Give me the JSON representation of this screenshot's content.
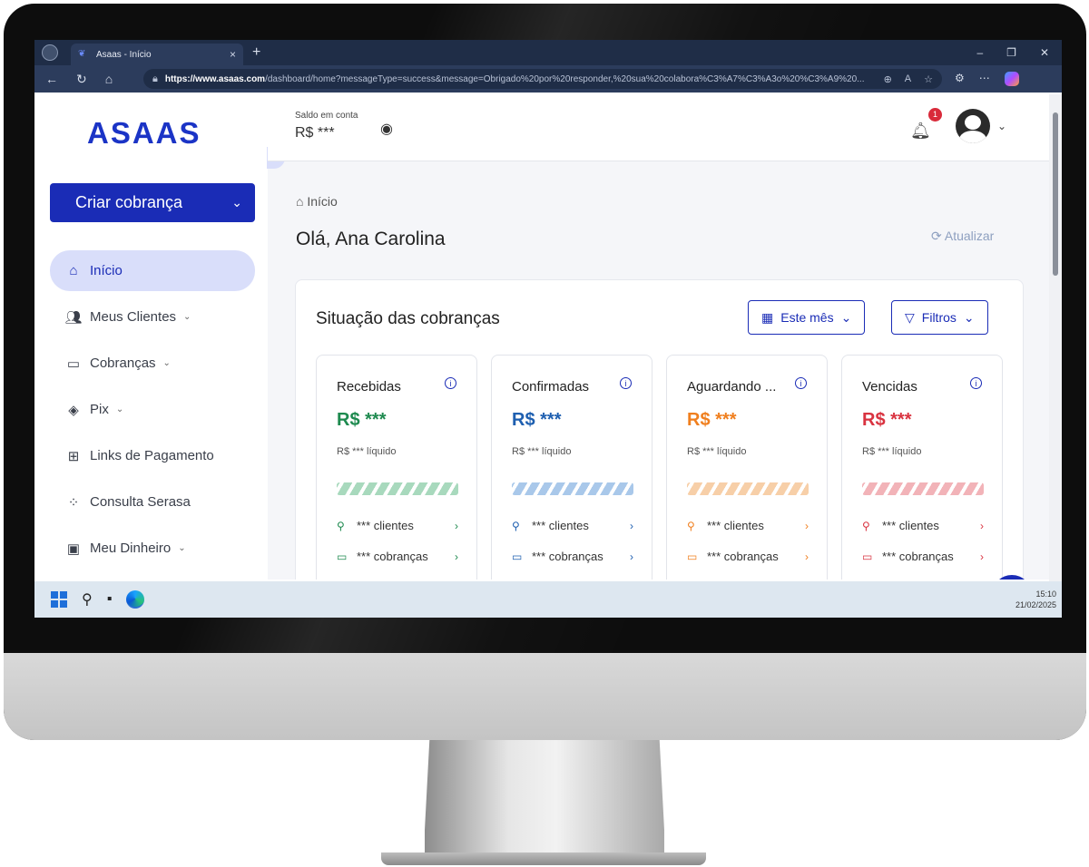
{
  "browser": {
    "tab_title": "Asaas - Início",
    "url_host": "https://www.asaas.com",
    "url_path": "/dashboard/home?messageType=success&message=Obrigado%20por%20responder,%20sua%20colabora%C3%A7%C3%A3o%20%C3%A9%20..."
  },
  "brand": {
    "logo": "ASAAS"
  },
  "sidebar": {
    "create_button": "Criar cobrança",
    "items": [
      {
        "label": "Início",
        "icon": "home-icon",
        "active": true,
        "dropdown": false
      },
      {
        "label": "Meus Clientes",
        "icon": "users-icon",
        "dropdown": true
      },
      {
        "label": "Cobranças",
        "icon": "money-icon",
        "dropdown": true
      },
      {
        "label": "Pix",
        "icon": "pix-icon",
        "dropdown": true
      },
      {
        "label": "Links de Pagamento",
        "icon": "link-icon",
        "dropdown": false
      },
      {
        "label": "Consulta Serasa",
        "icon": "serasa-icon",
        "dropdown": false
      },
      {
        "label": "Meu Dinheiro",
        "icon": "wallet-icon",
        "dropdown": true
      }
    ]
  },
  "topbar": {
    "balance_label": "Saldo em conta",
    "balance_value": "R$ ***",
    "notification_count": "1"
  },
  "main": {
    "breadcrumb": "Início",
    "greeting": "Olá, Ana Carolina",
    "refresh_label": "Atualizar",
    "panel": {
      "title": "Situação das cobranças",
      "period_button": "Este mês",
      "filter_button": "Filtros",
      "cards": [
        {
          "title": "Recebidas",
          "amount": "R$ ***",
          "net": "R$ *** líquido",
          "clients": "*** clientes",
          "charges": "*** cobranças",
          "color": "#1e8a4f",
          "bar": "#a8d9bd"
        },
        {
          "title": "Confirmadas",
          "amount": "R$ ***",
          "net": "R$ *** líquido",
          "clients": "*** clientes",
          "charges": "*** cobranças",
          "color": "#1e5fb0",
          "bar": "#a9c8ea"
        },
        {
          "title": "Aguardando ...",
          "amount": "R$ ***",
          "net": "R$ *** líquido",
          "clients": "*** clientes",
          "charges": "*** cobranças",
          "color": "#f07f1e",
          "bar": "#f7cfa8"
        },
        {
          "title": "Vencidas",
          "amount": "R$ ***",
          "net": "R$ *** líquido",
          "clients": "*** clientes",
          "charges": "*** cobranças",
          "color": "#d93340",
          "bar": "#f2b3b8"
        }
      ]
    }
  },
  "taskbar": {
    "time": "15:10",
    "date": "21/02/2025"
  }
}
